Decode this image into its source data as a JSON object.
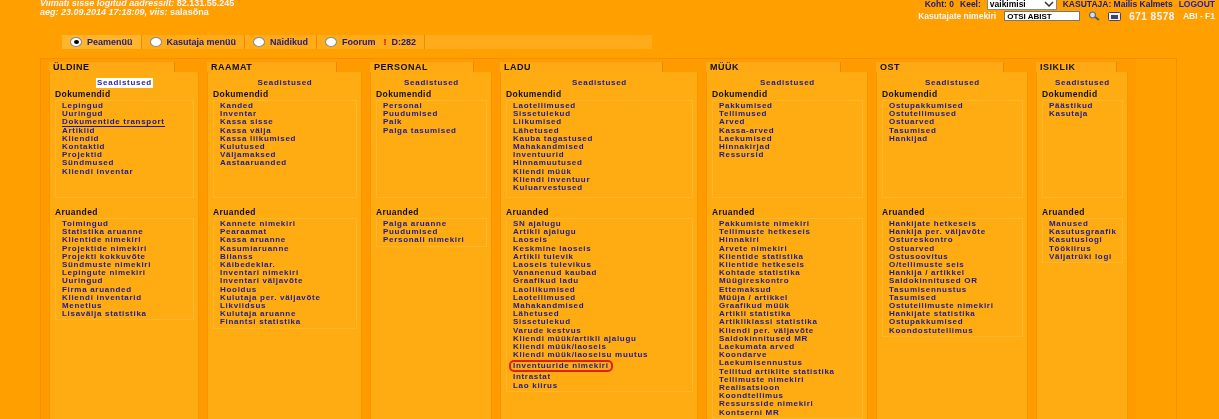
{
  "header": {
    "login_line": "*Viimati sisse logitud aadressilt:* **82.131.55.245**",
    "time_line": "*aeg: 23.09.2014 17:18:09, viis:* **salasõna**",
    "place": "Koht: 0",
    "language_label": "Keel:",
    "language_value": "vaikimisi",
    "user": "KASUTAJA: Mailis Kalmets",
    "logout": "LOGOUT",
    "users_link": "Kasutajate nimekiri",
    "help_search": "OTSI ABIST",
    "phone": "671 8578",
    "help_key": "ABI - F1"
  },
  "tabs": [
    {
      "label": "Peamenüü",
      "selected": true
    },
    {
      "label": "Kasutaja menüü",
      "selected": false
    },
    {
      "label": "Näidikud",
      "selected": false
    },
    {
      "label": "Foorum",
      "selected": false,
      "alert": "!",
      "count": "D:282"
    }
  ],
  "columns": [
    {
      "title": "ÜLDINE",
      "settings": {
        "label": "Seadistused",
        "selected": true
      },
      "documents_title": "Dokumendid",
      "documents": [
        {
          "label": "Lepingud",
          "hovered": false
        },
        {
          "label": "Uuringud",
          "hovered": false
        },
        {
          "label": "Dokumentide transport",
          "hovered": true
        },
        {
          "label": "Artiklid",
          "hovered": false
        },
        {
          "label": "Kliendid",
          "hovered": false
        },
        {
          "label": "Kontaktid",
          "hovered": false
        },
        {
          "label": "Projektid",
          "hovered": false
        },
        {
          "label": "Sündmused",
          "hovered": false
        },
        {
          "label": "Kliendi inventar",
          "hovered": false
        }
      ],
      "reports_title": "Aruanded",
      "reports": [
        "Toimingud",
        "Statistika aruanne",
        "Klientide nimekiri",
        "Projektide nimekiri",
        "Projekti kokkuvõte",
        "Sündmuste nimekiri",
        "Lepingute nimekiri",
        "Uuringud",
        "Firma aruanded",
        "Kliendi inventarid",
        "Menetlus",
        "Lisavälja statistika"
      ]
    },
    {
      "title": "RAAMAT",
      "settings": {
        "label": "Seadistused",
        "selected": false
      },
      "documents_title": "Dokumendid",
      "documents": [
        "Kanded",
        "Inventar",
        "Kassa sisse",
        "Kassa välja",
        "Kassa liikumised",
        "Kulutused",
        "Väljamaksed",
        "Aastaaruanded"
      ],
      "reports_title": "Aruanded",
      "reports": [
        "Kannete nimekiri",
        "Pearaamat",
        "Kassa aruanne",
        "Kasumiaruanne",
        "Bilanss",
        "Käibedeklar.",
        "Inventari nimekiri",
        "Inventari väljavõte",
        "Hooldus",
        "Kulutaja per. väljavõte",
        "Likviidsus",
        "Kulutaja aruanne",
        "Finantsi statistika"
      ]
    },
    {
      "title": "PERSONAL",
      "settings": {
        "label": "Seadistused",
        "selected": false
      },
      "documents_title": "Dokumendid",
      "documents": [
        "Personal",
        "Puudumised",
        "Palk",
        "Palga tasumised"
      ],
      "reports_title": "Aruanded",
      "reports": [
        "Palga aruanne",
        "Puudumised",
        "Personali nimekiri"
      ]
    },
    {
      "title": "LADU",
      "settings": {
        "label": "Seadistused",
        "selected": false
      },
      "documents_title": "Dokumendid",
      "documents": [
        "Laotellimused",
        "Sissetulekud",
        "Liikumised",
        "Lähetused",
        "Kauba tagastused",
        "Mahakandmised",
        "Inventuurid",
        "Hinnamuutused",
        "Kliendi müük",
        "Kliendi inventuur",
        "Kuluarvestused"
      ],
      "reports_title": "Aruanded",
      "reports": [
        {
          "label": "SN ajalugu",
          "highlighted": false
        },
        {
          "label": "Artikli ajalugu",
          "highlighted": false
        },
        {
          "label": "Laoseis",
          "highlighted": false
        },
        {
          "label": "Keskmine laoseis",
          "highlighted": false
        },
        {
          "label": "Artikli tulevik",
          "highlighted": false
        },
        {
          "label": "Laoseis tulevikus",
          "highlighted": false
        },
        {
          "label": "Vananenud kaubad",
          "highlighted": false
        },
        {
          "label": "Graafikud ladu",
          "highlighted": false
        },
        {
          "label": "Laoliikumised",
          "highlighted": false
        },
        {
          "label": "Laotellimused",
          "highlighted": false
        },
        {
          "label": "Mahakandmised",
          "highlighted": false
        },
        {
          "label": "Lähetused",
          "highlighted": false
        },
        {
          "label": "Sissetulekud",
          "highlighted": false
        },
        {
          "label": "Varude kestvus",
          "highlighted": false
        },
        {
          "label": "Kliendi müük/artikli ajalugu",
          "highlighted": false
        },
        {
          "label": "Kliendi müük/laoseis",
          "highlighted": false
        },
        {
          "label": "Kliendi müük/laoseisu muutus",
          "highlighted": false
        },
        {
          "label": "Inventuuride nimekiri",
          "highlighted": true
        },
        {
          "label": "Intrastat",
          "highlighted": false
        },
        {
          "label": "Lao kiirus",
          "highlighted": false
        }
      ]
    },
    {
      "title": "MÜÜK",
      "settings": {
        "label": "Seadistused",
        "selected": false
      },
      "documents_title": "Dokumendid",
      "documents": [
        "Pakkumised",
        "Tellimused",
        "Arved",
        "Kassa-arved",
        "Laekumised",
        "Hinnakirjad",
        "Ressursid"
      ],
      "reports_title": "Aruanded",
      "reports": [
        "Pakkumiste nimekiri",
        "Tellimuste hetkeseis",
        "Hinnakiri",
        "Arvete nimekiri",
        "Klientide statistika",
        "Klientide hetkeseis",
        "Kohtade statistika",
        "Müügireskontro",
        "Ettemaksud",
        "Müüja / artikkel",
        "Graafikud müük",
        "Artikli statistika",
        "Artikliklassi statistika",
        "Kliendi per. väljavõte",
        "Saldokinnitused MR",
        "Laekumata arved",
        "Koondarve",
        "Laekumisennustus",
        "Tellitud artiklite statistika",
        "Tellimuste nimekiri",
        "Realisatsioon",
        "Koondtellimus",
        "Ressursside nimekiri",
        "Kontserni MR"
      ]
    },
    {
      "title": "OST",
      "settings": {
        "label": "Seadistused",
        "selected": false
      },
      "documents_title": "Dokumendid",
      "documents": [
        "Ostupakkumised",
        "Ostutellimused",
        "Ostuarved",
        "Tasumised",
        "Hankijad"
      ],
      "reports_title": "Aruanded",
      "reports": [
        "Hankijate hetkeseis",
        "Hankija per. väljavõte",
        "Ostureskontro",
        "Ostuarved",
        "Ostusoovitus",
        "O/tellimuste seis",
        "Hankija / artikkel",
        "Saldokinnitused OR",
        "Tasumisennustus",
        "Tasumised",
        "Ostutellimuste nimekiri",
        "Hankijate statistika",
        "Ostupakkumised",
        "Koondostutellimus"
      ]
    },
    {
      "title": "ISIKLIK",
      "settings": {
        "label": "Seadistused",
        "selected": false
      },
      "documents_title": "Dokumendid",
      "documents": [
        "Päästikud",
        "Kasutaja"
      ],
      "reports_title": "Aruanded",
      "reports": [
        "Manused",
        "Kasutusgraafik",
        "Kasutuslogi",
        "Töökiirus",
        "Väljatrüki logi"
      ]
    }
  ]
}
